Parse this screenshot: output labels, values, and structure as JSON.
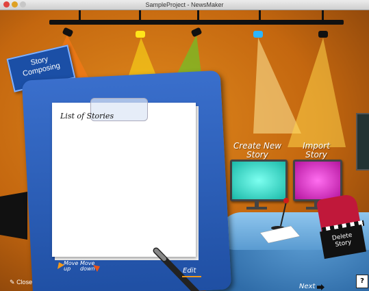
{
  "window": {
    "title": "SampleProject - NewsMaker"
  },
  "sign": {
    "line1": "Story",
    "line2": "Composing"
  },
  "clipboard": {
    "title": "List of Stories",
    "stories": [],
    "move_up": {
      "line1": "Move",
      "line2": "up"
    },
    "move_down": {
      "line1": "Move",
      "line2": "down"
    },
    "edit_label": "Edit"
  },
  "create_story": {
    "line1": "Create New",
    "line2": "Story"
  },
  "import_story": {
    "line1": "Import",
    "line2": "Story"
  },
  "delete_story": {
    "line1": "Delete",
    "line2": "Story"
  },
  "close_label": "Close",
  "next_label": "Next",
  "help_label": "?",
  "colors": {
    "scene_orange": "#d87816",
    "clipboard_blue": "#2a5fbf",
    "accent_orange": "#f39a1a",
    "chair_red": "#c0183a"
  },
  "icons": [
    "close-icon",
    "next-arrow-icon",
    "help-icon",
    "move-up-arrow-icon",
    "move-down-arrow-icon",
    "pen-icon"
  ]
}
